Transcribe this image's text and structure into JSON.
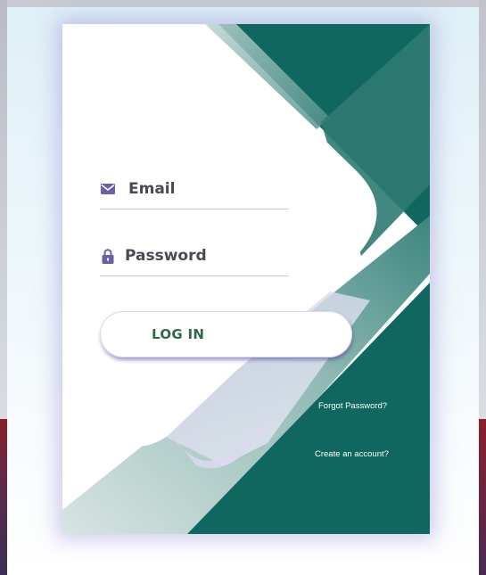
{
  "login": {
    "email_label": "Email",
    "password_label": "Password",
    "login_button": "LOG IN",
    "forgot_password": "Forgot Password?",
    "create_account": "Create an account?"
  },
  "icons": {
    "email": "envelope-icon",
    "password": "lock-icon"
  },
  "colors": {
    "teal_dark": "#0f6760",
    "teal_mid": "#5e9b95",
    "icon_purple": "#6c5ea8",
    "button_text": "#2e6b45",
    "card_glow": "#7a6ed0"
  }
}
